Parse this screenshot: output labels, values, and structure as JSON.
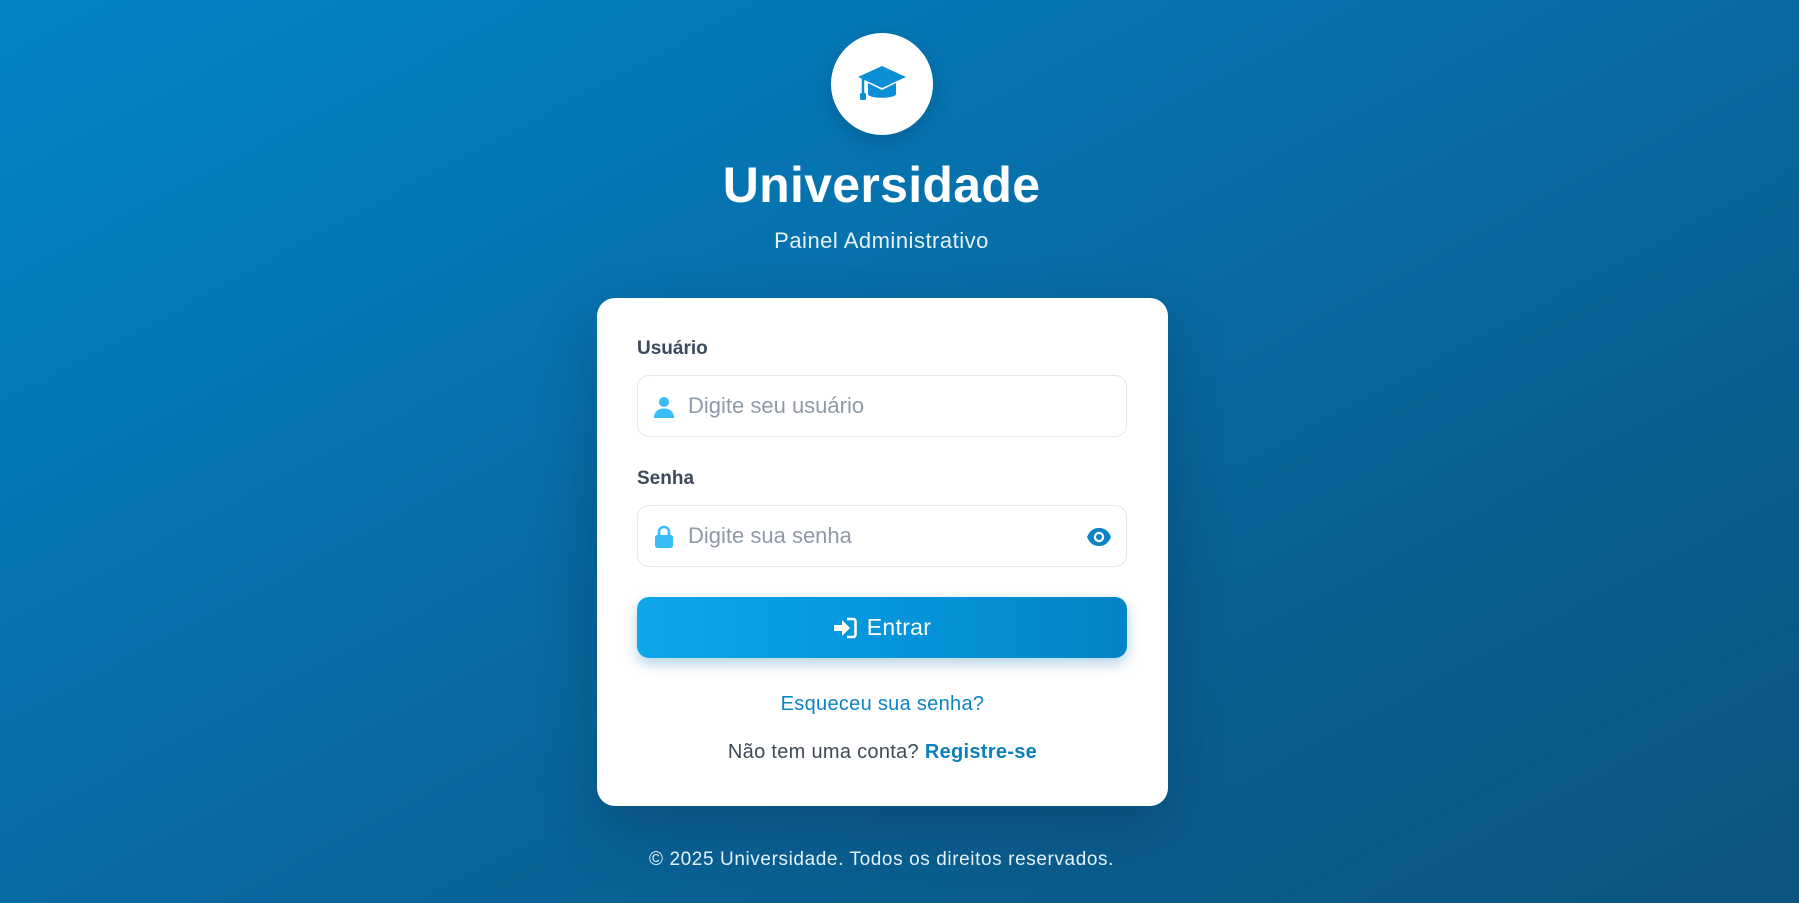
{
  "brand": {
    "icon": "graduation-cap-icon",
    "title": "Universidade",
    "subtitle": "Painel Administrativo"
  },
  "form": {
    "username": {
      "label": "Usuário",
      "placeholder": "Digite seu usuário",
      "value": "",
      "icon": "user-icon"
    },
    "password": {
      "label": "Senha",
      "placeholder": "Digite sua senha",
      "value": "",
      "icon": "lock-icon",
      "toggle_icon": "eye-icon"
    },
    "submit": {
      "label": "Entrar",
      "icon": "sign-in-icon"
    },
    "forgot_link": "Esqueceu sua senha?",
    "register_prompt": "Não tem uma conta?",
    "register_link": "Registre-se"
  },
  "footer": {
    "text": "© 2025 Universidade. Todos os direitos reservados."
  },
  "colors": {
    "background_start": "#0184c8",
    "background_end": "#0b5580",
    "accent": "#0596dc",
    "link": "#0a84c4",
    "icon": "#38bdf8"
  }
}
